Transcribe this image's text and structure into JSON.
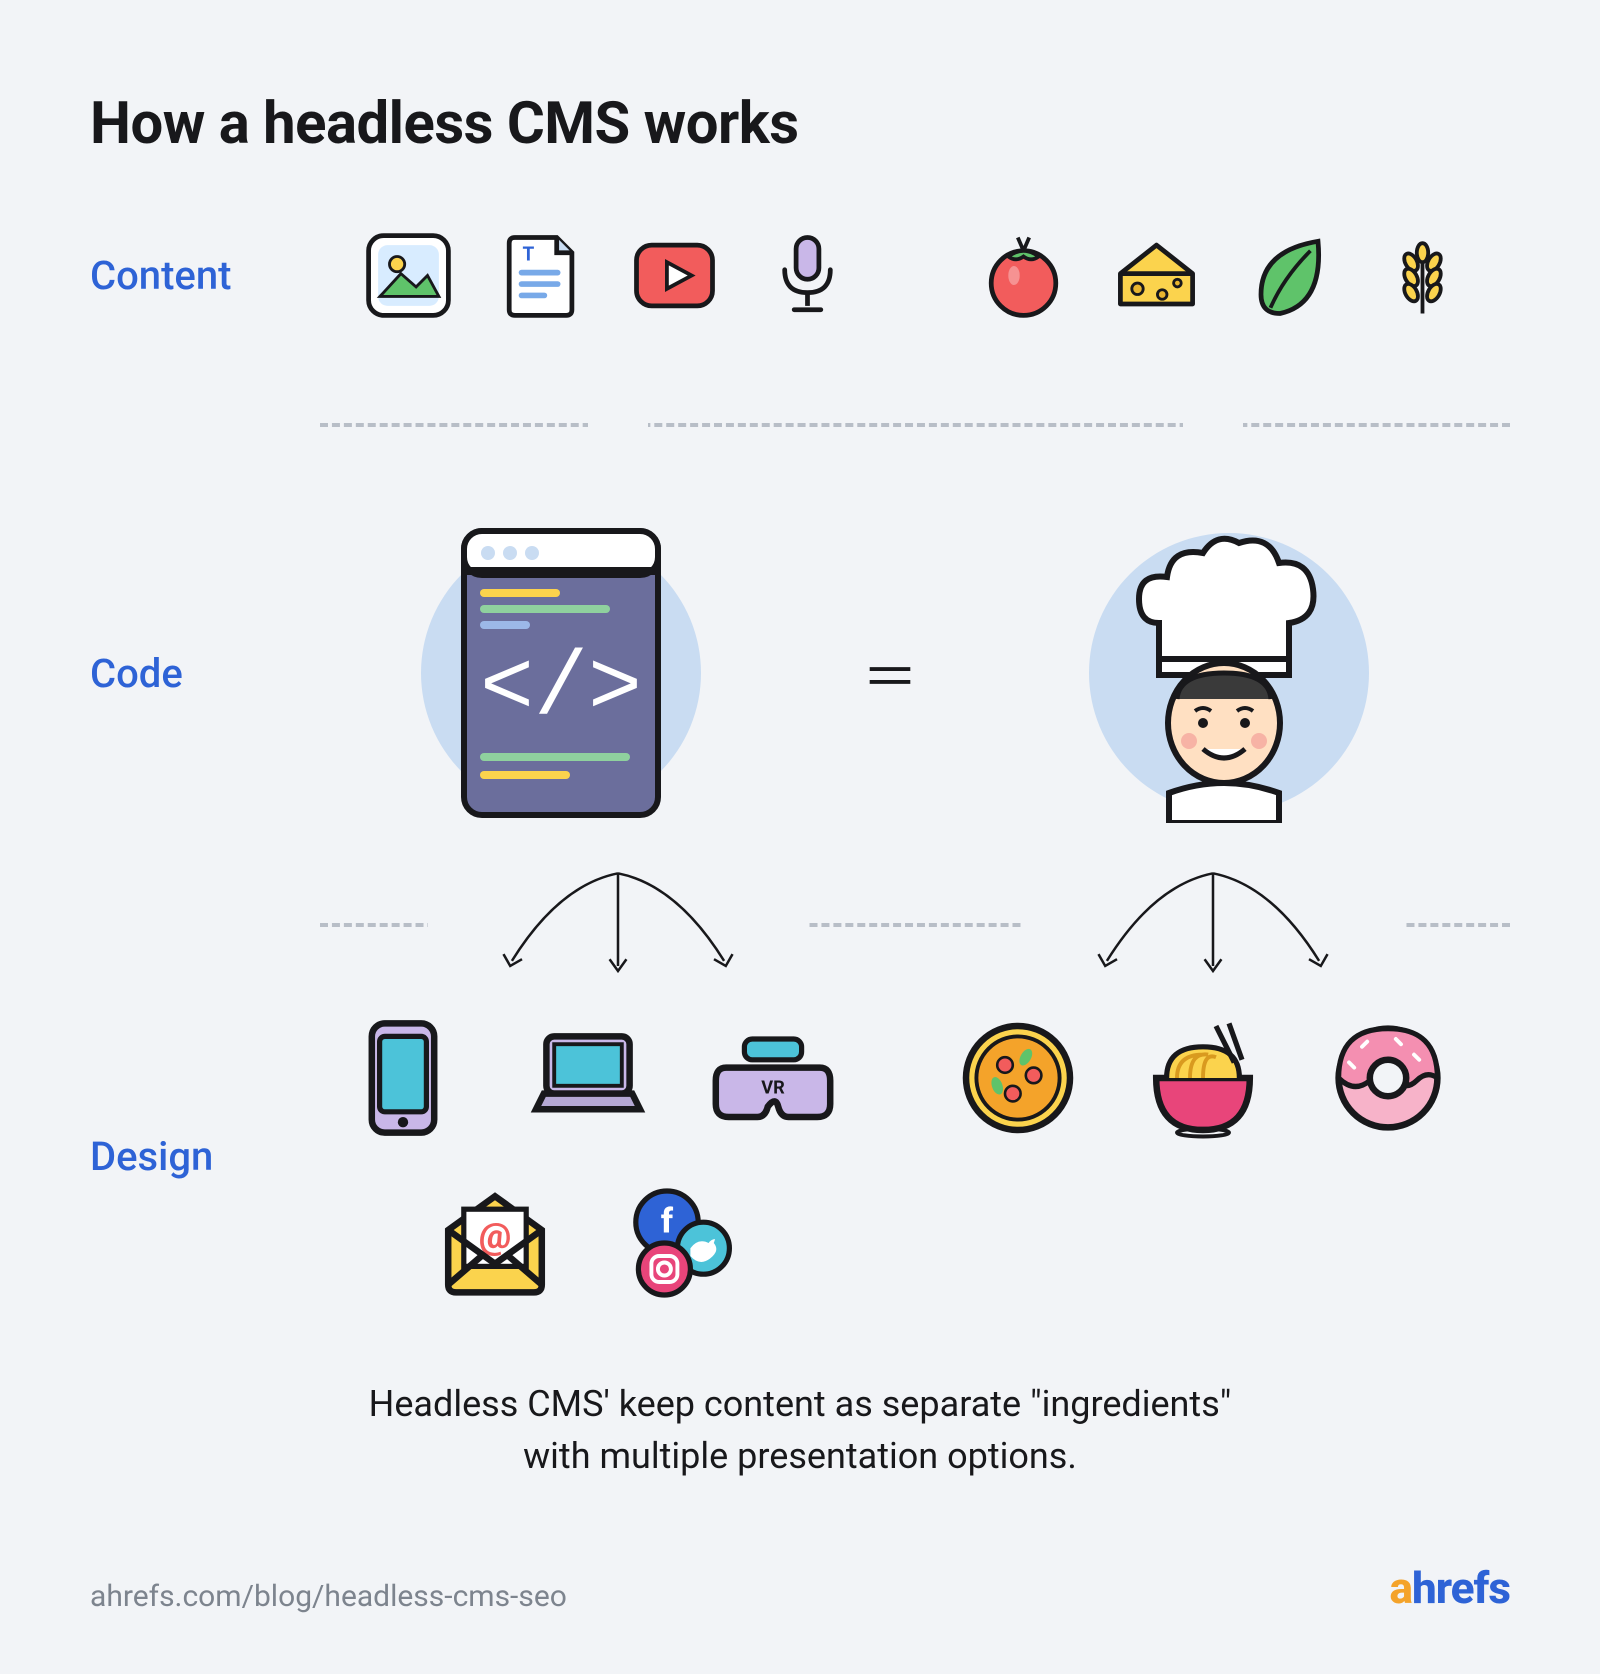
{
  "title": "How a headless CMS works",
  "labels": {
    "content": "Content",
    "code": "Code",
    "design": "Design"
  },
  "equals_symbol": "＝",
  "content_icons_left": [
    "image-icon",
    "document-icon",
    "video-icon",
    "microphone-icon"
  ],
  "content_icons_right": [
    "tomato-icon",
    "cheese-icon",
    "leaf-icon",
    "wheat-icon"
  ],
  "code_left": "code-window-icon",
  "code_right": "chef-icon",
  "design_outputs": [
    "phone-icon",
    "laptop-icon",
    "vr-headset-icon",
    "email-icon",
    "social-media-icon"
  ],
  "design_foods": [
    "pizza-icon",
    "noodles-icon",
    "donut-icon"
  ],
  "caption_line1": "Headless CMS' keep content as separate \"ingredients\"",
  "caption_line2": "with multiple presentation options.",
  "footer_url": "ahrefs.com/blog/headless-cms-seo",
  "brand_first": "a",
  "brand_rest": "hrefs",
  "colors": {
    "accent_blue": "#2e63d6",
    "accent_orange": "#f4a32a",
    "background": "#f2f4f7"
  }
}
